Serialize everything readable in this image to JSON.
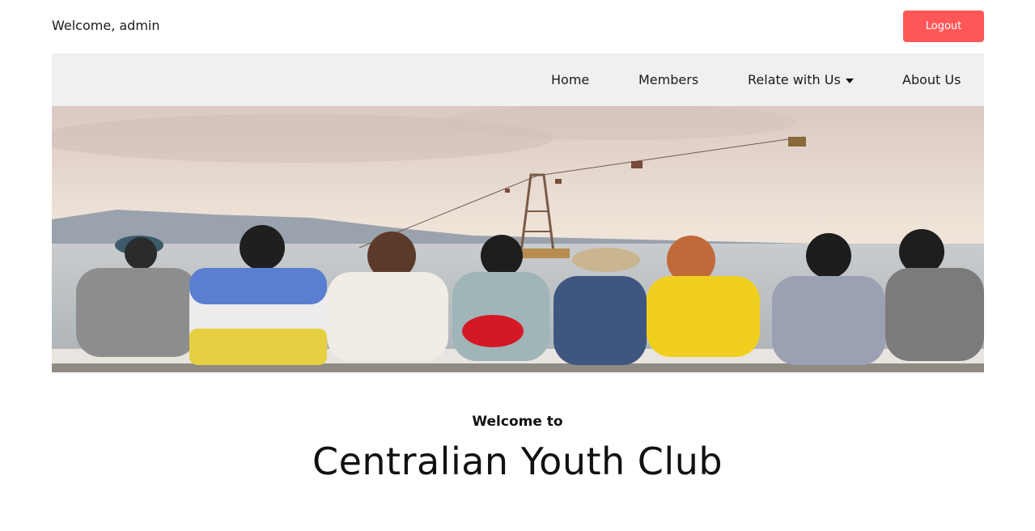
{
  "header": {
    "welcome": "Welcome, admin",
    "logout_label": "Logout"
  },
  "nav": {
    "items": [
      {
        "label": "Home"
      },
      {
        "label": "Members"
      },
      {
        "label": "Relate with Us",
        "has_dropdown": true
      },
      {
        "label": "About Us"
      }
    ]
  },
  "hero": {
    "image_subject": "group of young friends sitting arm-in-arm facing the sea with cable cars"
  },
  "intro": {
    "subtitle": "Welcome to",
    "title": "Centralian Youth Club"
  },
  "colors": {
    "accent": "#ff5757",
    "nav_bg": "#f0f0f0"
  }
}
